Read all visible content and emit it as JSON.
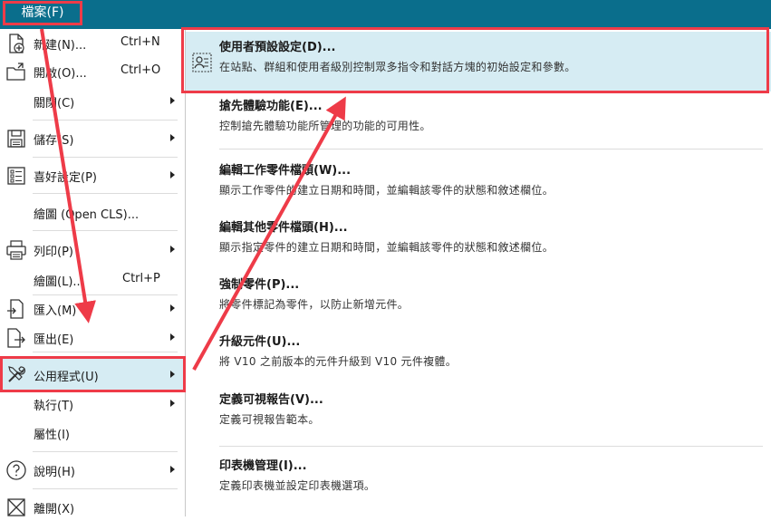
{
  "titlebar": {
    "file_tab": "檔案(F)"
  },
  "left_menu": {
    "items": [
      {
        "label": "新建(N)...",
        "shortcut": "Ctrl+N",
        "icon": "new-document-icon"
      },
      {
        "label": "開啟(O)...",
        "shortcut": "Ctrl+O",
        "icon": "open-folder-icon"
      },
      {
        "label": "關閉(C)",
        "submenu": true
      },
      {
        "label": "儲存(S)",
        "submenu": true,
        "icon": "save-disk-icon"
      },
      {
        "label": "喜好設定(P)",
        "submenu": true,
        "icon": "preferences-list-icon"
      },
      {
        "label": "繪圖 (Open CLS)...",
        "submenu": false
      },
      {
        "label": "列印(P)",
        "submenu": true,
        "icon": "printer-icon"
      },
      {
        "label": "繪圖(L)...",
        "shortcut": "Ctrl+P"
      },
      {
        "label": "匯入(M)",
        "submenu": true,
        "icon": "import-icon"
      },
      {
        "label": "匯出(E)",
        "submenu": true,
        "icon": "export-icon"
      },
      {
        "label": "公用程式(U)",
        "submenu": true,
        "icon": "utilities-tools-icon",
        "selected": true
      },
      {
        "label": "執行(T)",
        "submenu": true
      },
      {
        "label": "屬性(I)"
      },
      {
        "label": "說明(H)",
        "submenu": true,
        "icon": "help-icon"
      },
      {
        "label": "離開(X)",
        "icon": "exit-icon"
      }
    ]
  },
  "submenu": {
    "items": [
      {
        "title": "使用者預設設定(D)...",
        "desc": "在站點、群組和使用者級別控制眾多指令和對話方塊的初始設定和參數。",
        "selected": true
      },
      {
        "title": "搶先體驗功能(E)...",
        "desc": "控制搶先體驗功能所管理的功能的可用性。"
      },
      {
        "title": "編輯工作零件檔頭(W)...",
        "desc": "顯示工作零件的建立日期和時間，並編輯該零件的狀態和敘述欄位。"
      },
      {
        "title": "編輯其他零件檔頭(H)...",
        "desc": "顯示指定零件的建立日期和時間，並編輯該零件的狀態和敘述欄位。"
      },
      {
        "title": "強制零件(P)...",
        "desc": "將零件標記為零件，以防止新增元件。"
      },
      {
        "title": "升級元件(U)...",
        "desc": "將 V10 之前版本的元件升級到 V10 元件複體。"
      },
      {
        "title": "定義可視報告(V)...",
        "desc": "定義可視報告範本。"
      },
      {
        "title": "印表機管理(I)...",
        "desc": "定義印表機並設定印表機選項。"
      }
    ]
  },
  "colors": {
    "titlebar": "#0a6e8c",
    "highlight": "#d6ecf3",
    "annotation_red": "#ee3b48"
  }
}
